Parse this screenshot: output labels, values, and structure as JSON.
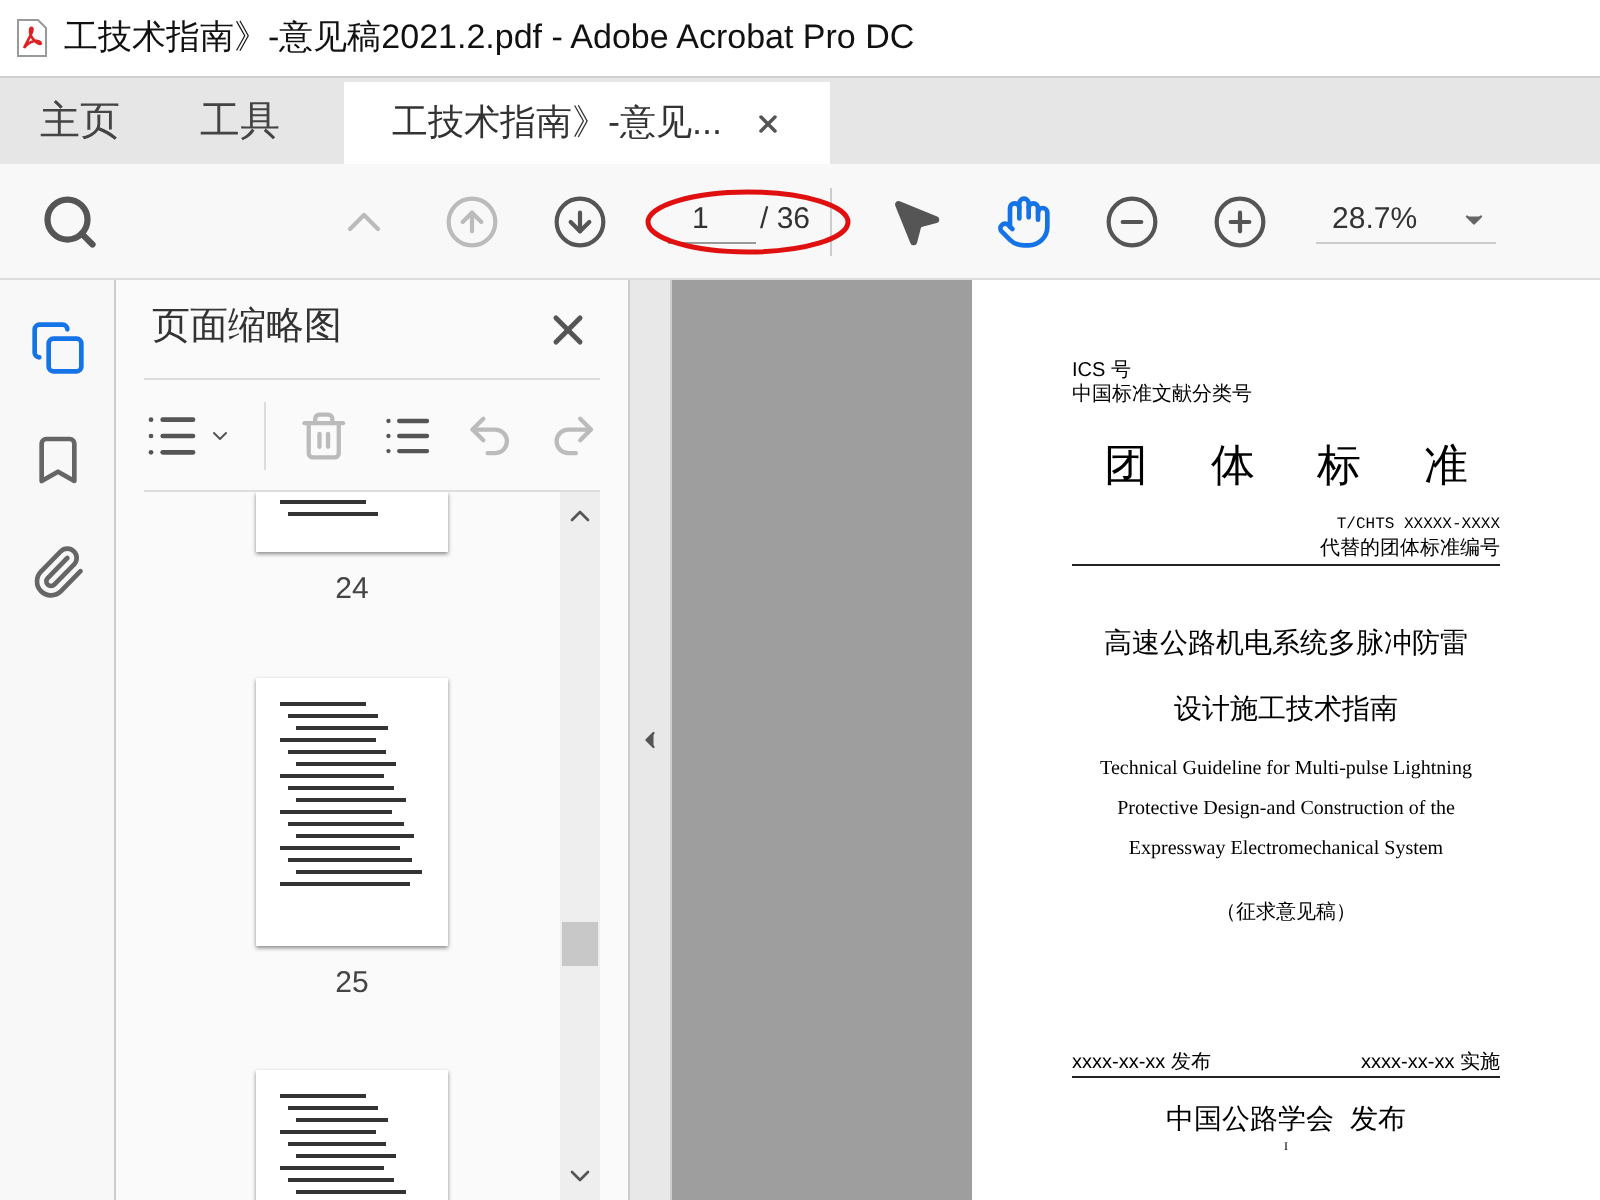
{
  "window": {
    "title": "工技术指南》-意见稿2021.2.pdf - Adobe Acrobat Pro DC"
  },
  "nav_tabs": [
    {
      "label": "主页",
      "selected": false
    },
    {
      "label": "工具",
      "selected": false
    },
    {
      "label": "工技术指南》-意见...",
      "selected": true
    }
  ],
  "toolbar": {
    "nav_buttons": [
      {
        "kind": "first",
        "disabled": true
      },
      {
        "kind": "prev",
        "disabled": true
      },
      {
        "kind": "next",
        "disabled": false
      }
    ],
    "page_current": "1",
    "page_total": "/ 36",
    "tools": [
      {
        "kind": "select",
        "selected": false
      },
      {
        "kind": "hand",
        "selected": true
      }
    ],
    "zoom": "28.7%"
  },
  "left_rail": [
    {
      "kind": "pages",
      "selected": true
    },
    {
      "kind": "bookmarks",
      "selected": false
    },
    {
      "kind": "attachments",
      "selected": false
    }
  ],
  "thumbnail_panel": {
    "title": "页面缩略图",
    "actions": [
      {
        "kind": "delete",
        "disabled": true
      },
      {
        "kind": "insert",
        "disabled": false
      },
      {
        "kind": "undo",
        "disabled": true
      },
      {
        "kind": "redo",
        "disabled": true
      }
    ],
    "thumbnails": [
      {
        "label": "24"
      },
      {
        "label": "25"
      }
    ]
  },
  "document": {
    "ics": "ICS 号",
    "ccs": "中国标准文献分类号",
    "heading": [
      "团",
      "体",
      "标",
      "准"
    ],
    "code": "T/CHTS XXXXX-XXXX",
    "code_note": "代替的团体标准编号",
    "title_lines": [
      "高速公路机电系统多脉冲防雷",
      "设计施工技术指南"
    ],
    "english_title": "Technical Guideline for Multi-pulse Lightning Protective Design-and Construction of the Expressway Electromechanical System",
    "draft_note": "（征求意见稿）",
    "issue_date": "xxxx-xx-xx 发布",
    "effective_date": "xxxx-xx-xx 实施",
    "publisher": "中国公路学会  发布",
    "page_mark": "I"
  }
}
